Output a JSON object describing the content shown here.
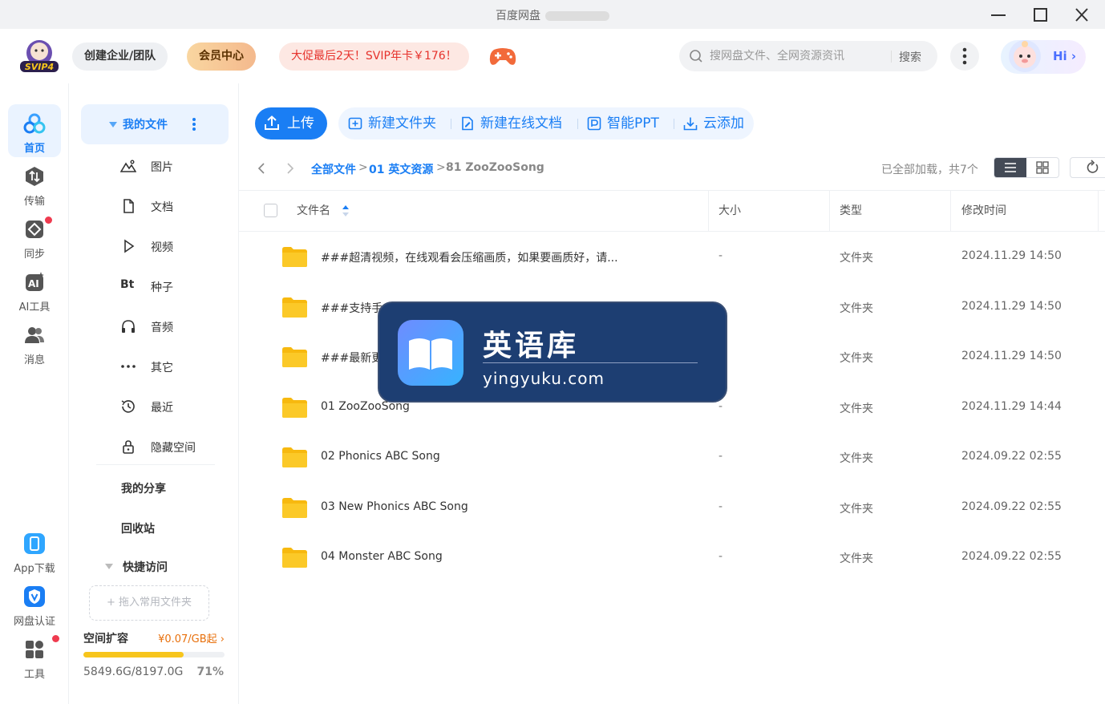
{
  "window": {
    "title": "百度网盘"
  },
  "header": {
    "logo_badge": "SVIP4",
    "create_team": "创建企业/团队",
    "vip_center": "会员中心",
    "promo": "大促最后2天！SVIP年卡￥176！",
    "search_placeholder": "搜网盘文件、全网资源资讯",
    "search_button": "搜索",
    "hi": "Hi"
  },
  "leftnav": {
    "items": [
      {
        "label": "首页"
      },
      {
        "label": "传输"
      },
      {
        "label": "同步"
      },
      {
        "label": "AI工具"
      },
      {
        "label": "消息"
      }
    ],
    "bottom": [
      {
        "label": "App下载"
      },
      {
        "label": "网盘认证"
      },
      {
        "label": "工具"
      }
    ]
  },
  "sidebar": {
    "my_files": "我的文件",
    "sub_items": [
      "图片",
      "文档",
      "视频",
      "种子",
      "音频",
      "其它",
      "最近",
      "隐藏空间"
    ],
    "bt_glyph": "Bt",
    "my_share": "我的分享",
    "recycle": "回收站",
    "quick_access": "快捷访问",
    "drop_hint": "+ 拖入常用文件夹",
    "expand_title": "空间扩容",
    "expand_price": "¥0.07/GB起",
    "quota_text": "5849.6G/8197.0G",
    "quota_pct": "71%",
    "quota_fraction": 0.71
  },
  "toolbar": {
    "upload": "上传",
    "new_folder": "新建文件夹",
    "new_doc": "新建在线文档",
    "smart_ppt": "智能PPT",
    "cloud_add": "云添加"
  },
  "breadcrumb": {
    "all_files": "全部文件",
    "folder1": "01 英文资源",
    "current": "81 ZooZooSong",
    "sep": ">",
    "loaded": "已全部加载，共7个"
  },
  "table": {
    "headers": {
      "name": "文件名",
      "size": "大小",
      "type": "类型",
      "modified": "修改时间"
    },
    "rows": [
      {
        "name": "###超清视频，在线观看会压缩画质，如果要画质好，请...",
        "size": "-",
        "type": "文件夹",
        "modified": "2024.11.29 14:50"
      },
      {
        "name": "###支持手",
        "size": "-",
        "type": "文件夹",
        "modified": "2024.11.29 14:50"
      },
      {
        "name": "###最新更",
        "size": "-",
        "type": "文件夹",
        "modified": "2024.11.29 14:50"
      },
      {
        "name": "01 ZooZooSong",
        "size": "-",
        "type": "文件夹",
        "modified": "2024.11.29 14:44"
      },
      {
        "name": "02 Phonics ABC Song",
        "size": "-",
        "type": "文件夹",
        "modified": "2024.09.22 02:55"
      },
      {
        "name": "03 New Phonics ABC Song",
        "size": "-",
        "type": "文件夹",
        "modified": "2024.09.22 02:55"
      },
      {
        "name": "04 Monster ABC Song",
        "size": "-",
        "type": "文件夹",
        "modified": "2024.09.22 02:55"
      }
    ]
  },
  "watermark": {
    "title": "英语库",
    "url": "yingyuku.com"
  },
  "colors": {
    "accent": "#1a7ef4",
    "promo_red": "#e6322c",
    "quota_yellow": "#f7c51c",
    "folder_yellow": "#fbc928"
  }
}
